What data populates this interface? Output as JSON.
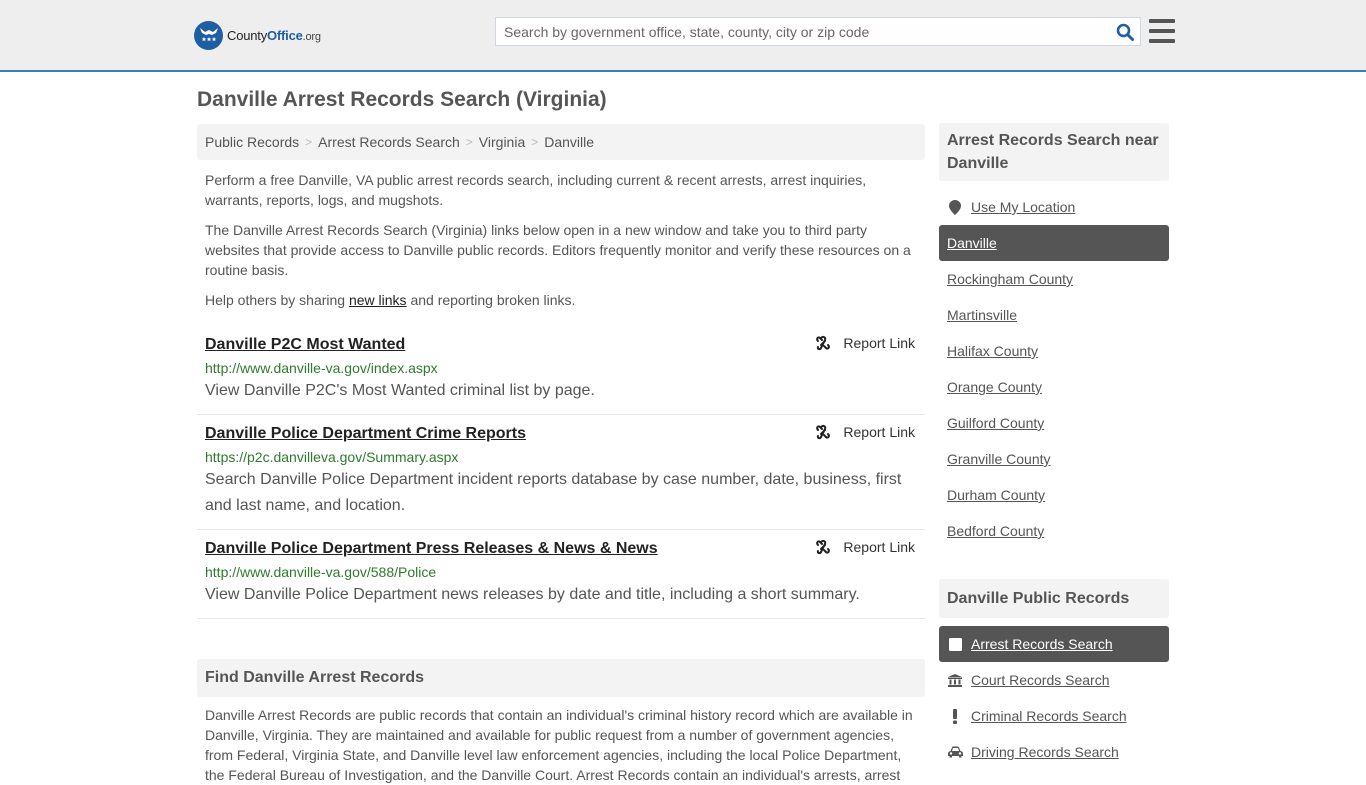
{
  "header": {
    "logo": {
      "brand": "County",
      "brand_bold": "Office",
      "tld": ".org"
    },
    "search": {
      "placeholder": "Search by government office, state, county, city or zip code",
      "value": ""
    },
    "icons": {
      "search": "search-icon",
      "menu": "hamburger-menu-icon"
    }
  },
  "page": {
    "title": "Danville Arrest Records Search (Virginia)"
  },
  "breadcrumb": [
    {
      "label": "Public Records"
    },
    {
      "label": "Arrest Records Search"
    },
    {
      "label": "Virginia"
    },
    {
      "label": "Danville"
    }
  ],
  "breadcrumb_separator": ">",
  "intro": {
    "p1": "Perform a free Danville, VA public arrest records search, including current & recent arrests, arrest inquiries, warrants, reports, logs, and mugshots.",
    "p2": "The Danville Arrest Records Search (Virginia) links below open in a new window and take you to third party websites that provide access to Danville public records. Editors frequently monitor and verify these resources on a routine basis.",
    "p3_before": "Help others by sharing ",
    "p3_link": "new links",
    "p3_after": " and reporting broken links."
  },
  "listings": [
    {
      "title": "Danville P2C Most Wanted",
      "url": "http://www.danville-va.gov/index.aspx",
      "description": "View Danville P2C's Most Wanted criminal list by page.",
      "report_label": "Report Link"
    },
    {
      "title": "Danville Police Department Crime Reports",
      "url": "https://p2c.danvilleva.gov/Summary.aspx",
      "description": "Search Danville Police Department incident reports database by case number, date, business, first and last name, and location.",
      "report_label": "Report Link"
    },
    {
      "title": "Danville Police Department Press Releases & News & News",
      "url": "http://www.danville-va.gov/588/Police",
      "description": "View Danville Police Department news releases by date and title, including a short summary.",
      "report_label": "Report Link"
    }
  ],
  "find_section": {
    "title": "Find Danville Arrest Records",
    "body": "Danville Arrest Records are public records that contain an individual's criminal history record which are available in Danville, Virginia. They are maintained and available for public request from a number of government agencies, from Federal, Virginia State, and Danville level law enforcement agencies, including the local Police Department, the Federal Bureau of Investigation, and the Danville Court. Arrest Records contain an individual's arrests, arrest"
  },
  "sidebar": {
    "nearby": {
      "title": "Arrest Records Search near Danville",
      "use_location": "Use My Location",
      "items": [
        {
          "label": "Danville",
          "active": true
        },
        {
          "label": "Rockingham County"
        },
        {
          "label": "Martinsville"
        },
        {
          "label": "Halifax County"
        },
        {
          "label": "Orange County"
        },
        {
          "label": "Guilford County"
        },
        {
          "label": "Granville County"
        },
        {
          "label": "Durham County"
        },
        {
          "label": "Bedford County"
        }
      ]
    },
    "public_records": {
      "title": "Danville Public Records",
      "items": [
        {
          "label": "Arrest Records Search",
          "icon": "square-icon",
          "active": true
        },
        {
          "label": "Court Records Search",
          "icon": "courthouse-icon"
        },
        {
          "label": "Criminal Records Search",
          "icon": "exclamation-icon"
        },
        {
          "label": "Driving Records Search",
          "icon": "car-icon"
        }
      ]
    }
  },
  "colors": {
    "header_bg": "#eeeeee",
    "header_border": "#3a7eb0",
    "brand_blue": "#1f5ea2",
    "link_green": "#2f7a2f",
    "active_bg": "#555555",
    "panel_bg": "#f3f3f3"
  }
}
